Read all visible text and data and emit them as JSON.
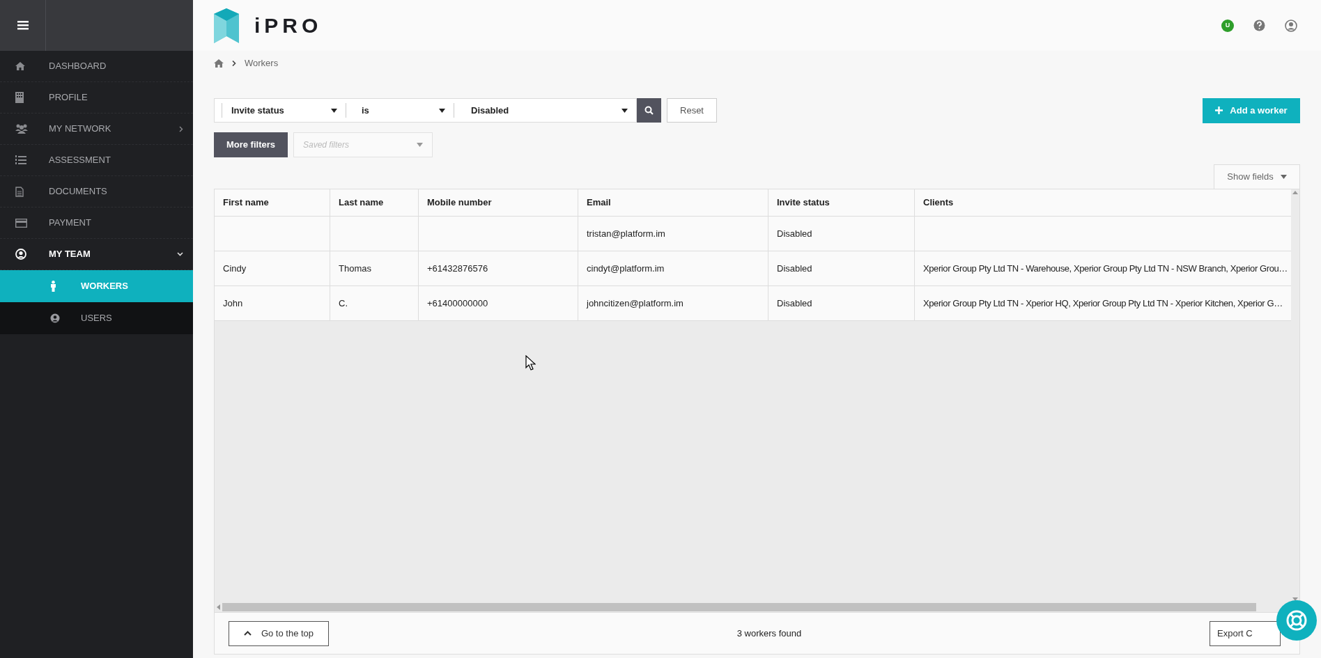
{
  "app": {
    "logo_text": "iPRO"
  },
  "sidebar": {
    "items": [
      {
        "label": "DASHBOARD",
        "selected": false
      },
      {
        "label": "PROFILE",
        "selected": false
      },
      {
        "label": "MY NETWORK",
        "selected": false,
        "expanded": false
      },
      {
        "label": "ASSESSMENT",
        "selected": false
      },
      {
        "label": "DOCUMENTS",
        "selected": false
      },
      {
        "label": "PAYMENT",
        "selected": false
      },
      {
        "label": "MY TEAM",
        "selected": false,
        "expanded": true,
        "children": [
          {
            "label": "WORKERS",
            "selected": true
          },
          {
            "label": "USERS",
            "selected": false
          }
        ]
      }
    ]
  },
  "header": {
    "status_badge": "U"
  },
  "breadcrumb": [
    "Workers"
  ],
  "filter": {
    "field": "Invite status",
    "operator": "is",
    "value": "Disabled",
    "reset": "Reset",
    "more_filters": "More filters",
    "saved_filters_placeholder": "Saved filters"
  },
  "add_button": "Add a worker",
  "show_fields": "Show fields",
  "table": {
    "columns": [
      "First name",
      "Last name",
      "Mobile number",
      "Email",
      "Invite status",
      "Clients"
    ],
    "rows": [
      [
        "",
        "",
        "",
        "tristan@platform.im",
        "Disabled",
        ""
      ],
      [
        "Cindy",
        "Thomas",
        "+61432876576",
        "cindyt@platform.im",
        "Disabled",
        "Xperior Group Pty Ltd TN - Warehouse, Xperior Group Pty Ltd TN - NSW Branch, Xperior Grou…"
      ],
      [
        "John",
        "C.",
        "+61400000000",
        "johncitizen@platform.im",
        "Disabled",
        "Xperior Group Pty Ltd TN - Xperior HQ, Xperior Group Pty Ltd TN - Xperior Kitchen, Xperior G…"
      ]
    ]
  },
  "footer": {
    "go_to_top": "Go to the top",
    "count": "3 workers found",
    "export": "Export C"
  }
}
